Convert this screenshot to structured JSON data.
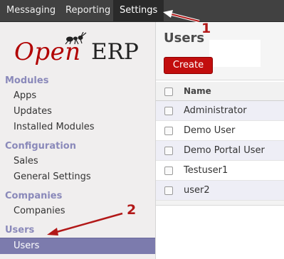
{
  "topbar": {
    "menus": [
      {
        "label": "Messaging"
      },
      {
        "label": "Reporting"
      },
      {
        "label": "Settings",
        "active": true
      }
    ]
  },
  "logo": {
    "part1": "Open",
    "part2": "ERP"
  },
  "sidebar": {
    "sections": [
      {
        "title": "Modules",
        "items": [
          "Apps",
          "Updates",
          "Installed Modules"
        ]
      },
      {
        "title": "Configuration",
        "items": [
          "Sales",
          "General Settings"
        ]
      },
      {
        "title": "Companies",
        "items": [
          "Companies"
        ]
      },
      {
        "title": "Users",
        "items": [
          "Users"
        ]
      }
    ],
    "selected": "Users"
  },
  "main": {
    "title": "Users",
    "create_label": "Create",
    "table": {
      "header": "Name",
      "rows": [
        "Administrator",
        "Demo User",
        "Demo Portal User",
        "Testuser1",
        "user2"
      ]
    }
  },
  "annotations": {
    "step1": "1",
    "step2": "2"
  },
  "colors": {
    "accent": "#7c7bad",
    "brand": "#c20e0e",
    "annotation": "#b21818"
  }
}
